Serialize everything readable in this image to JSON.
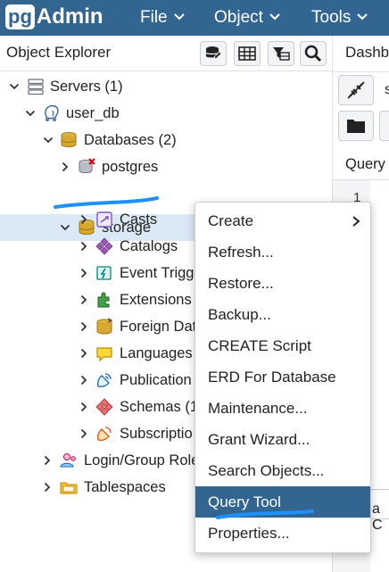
{
  "brand": {
    "pg": "pg",
    "admin": "Admin"
  },
  "menubar": [
    {
      "label": "File"
    },
    {
      "label": "Object"
    },
    {
      "label": "Tools"
    }
  ],
  "explorer": {
    "title": "Object Explorer",
    "toolbar_icons": [
      "database-query-icon",
      "table-view-icon",
      "filter-rows-icon",
      "search-icon"
    ]
  },
  "tree": {
    "servers": "Servers (1)",
    "server": "user_db",
    "databases": "Databases (2)",
    "db_postgres": "postgres",
    "db_storage": "storage",
    "casts": "Casts",
    "catalogs": "Catalogs",
    "event_triggers": "Event Trigg",
    "extensions": "Extensions",
    "foreign_data": "Foreign Dat",
    "languages": "Languages",
    "publications": "Publication",
    "schemas": "Schemas (1",
    "subscriptions": "Subscriptio",
    "login_roles": "Login/Group Role",
    "tablespaces": "Tablespaces"
  },
  "right_panel": {
    "dashboard_tab": "Dashb",
    "server_field_partial": "s",
    "query_tab": "Query",
    "line_number": "1",
    "hidden_text": "a C"
  },
  "context_menu": {
    "items": [
      {
        "label": "Create",
        "has_submenu": true
      },
      {
        "label": "Refresh..."
      },
      {
        "label": "Restore..."
      },
      {
        "label": "Backup..."
      },
      {
        "label": "CREATE Script"
      },
      {
        "label": "ERD For Database"
      },
      {
        "label": "Maintenance..."
      },
      {
        "label": "Grant Wizard..."
      },
      {
        "label": "Search Objects..."
      },
      {
        "label": "Query Tool",
        "active": true
      },
      {
        "label": "Properties..."
      }
    ]
  },
  "colors": {
    "navbar": "#326690",
    "selection_bg": "#dbe8f6",
    "menu_active": "#326690",
    "annotation": "#1e90ff"
  }
}
